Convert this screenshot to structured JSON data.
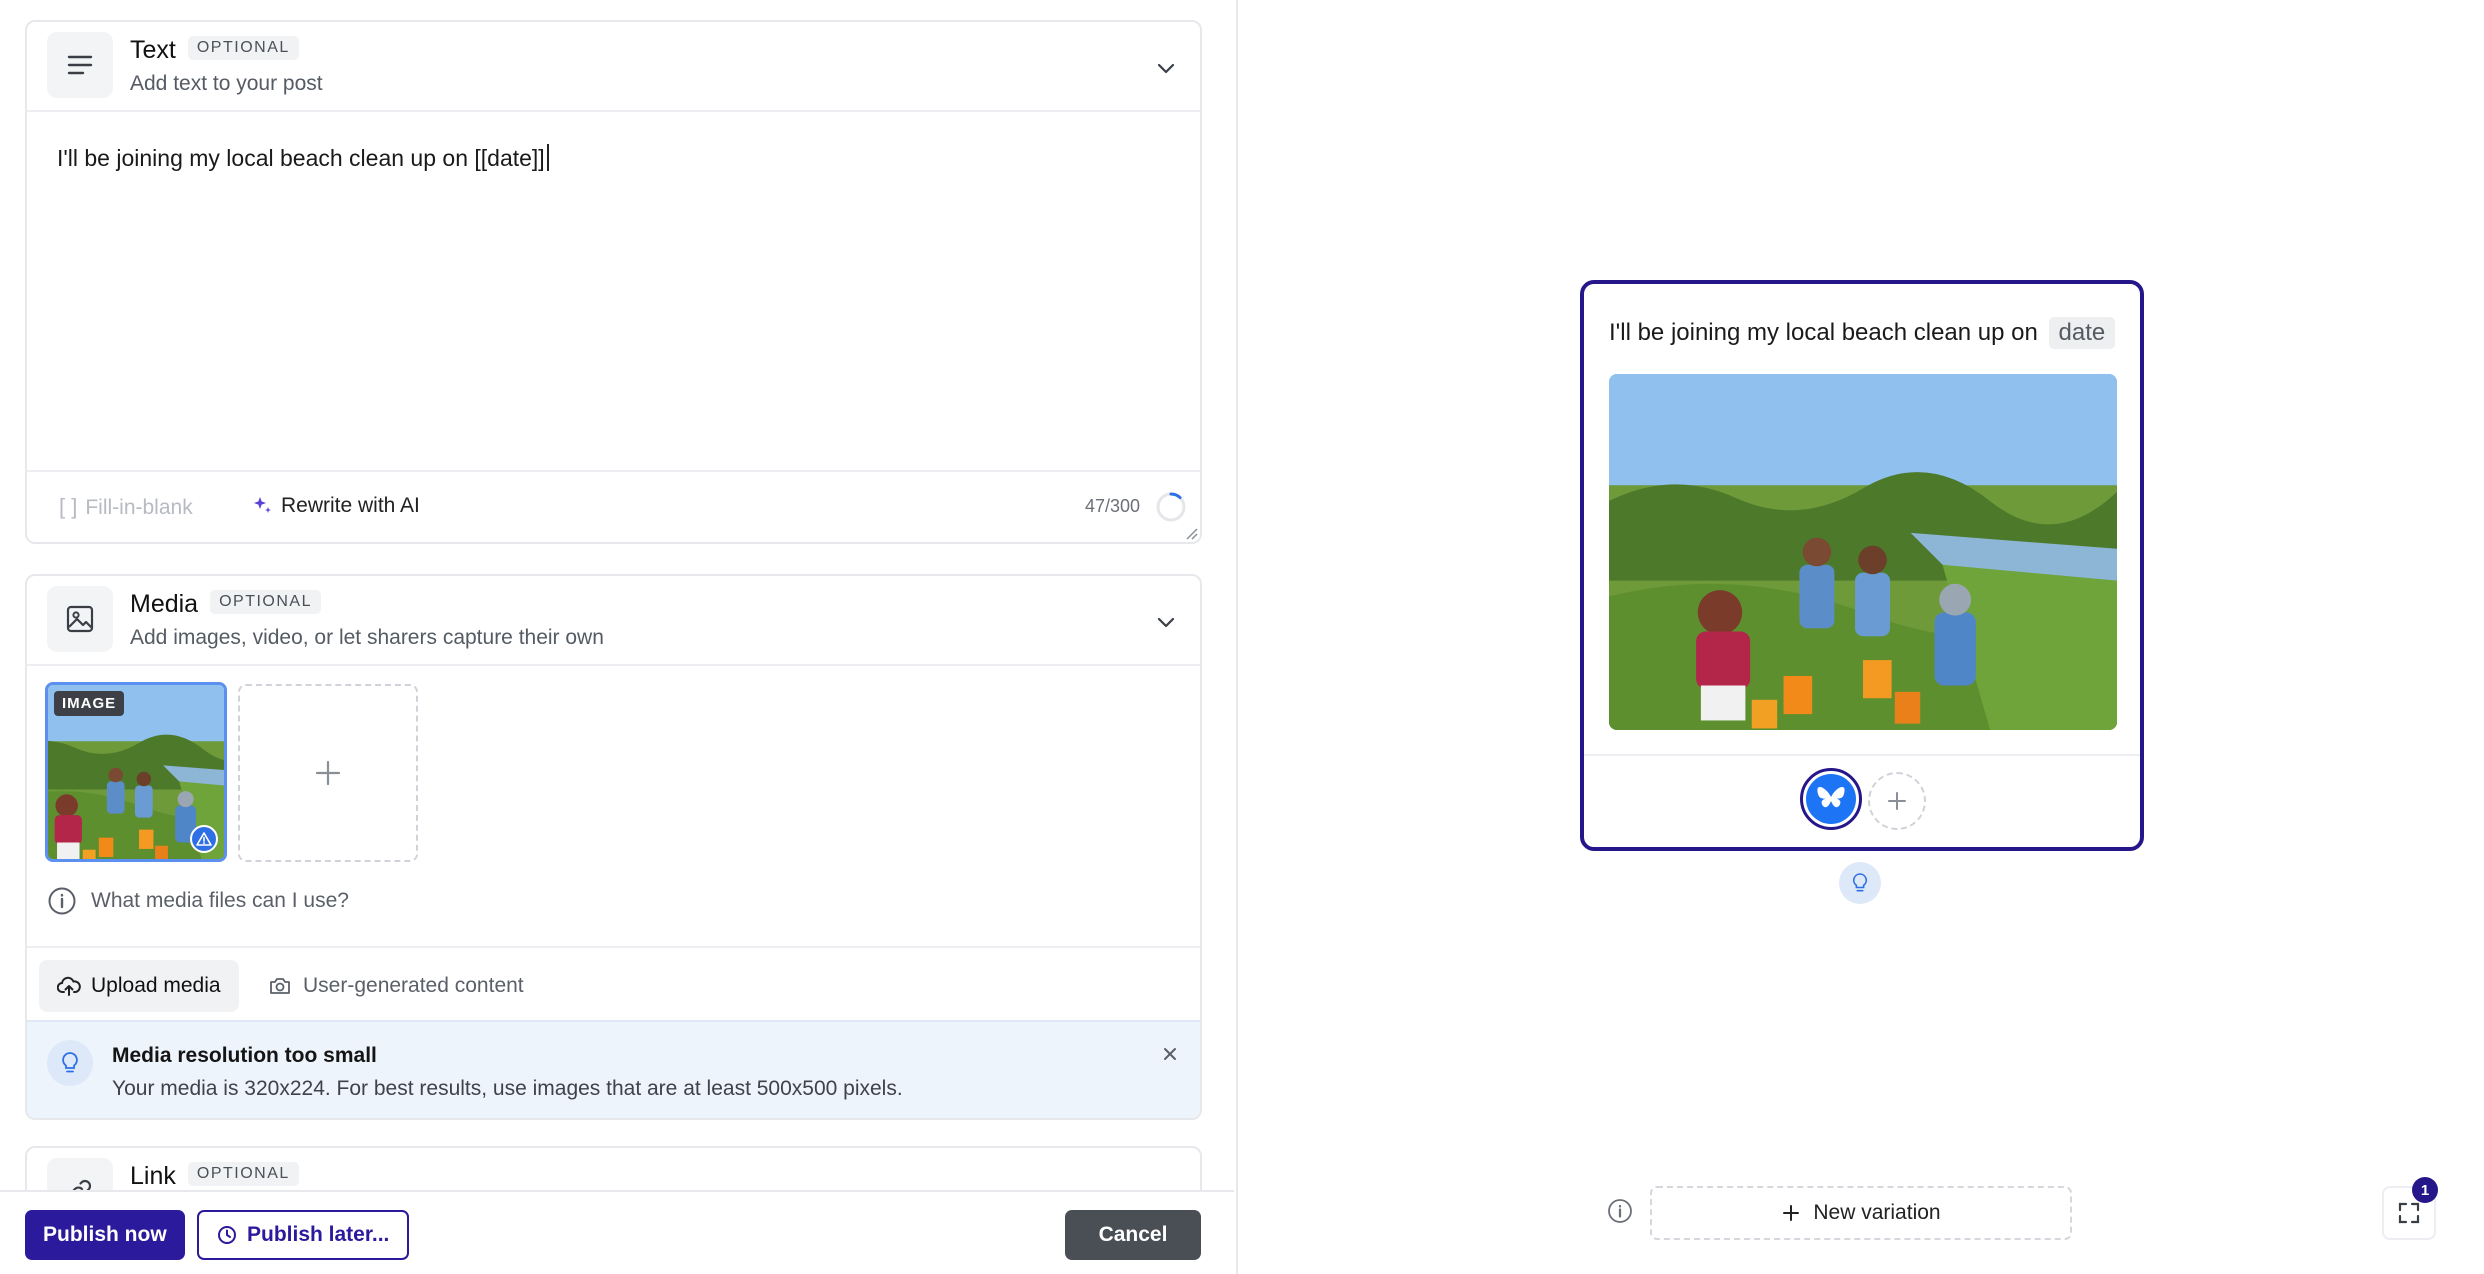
{
  "text_section": {
    "title": "Text",
    "badge": "OPTIONAL",
    "subtitle": "Add text to your post",
    "content": "I'll be joining my local beach clean up on [[date]]",
    "fill_in_blank": "Fill-in-blank",
    "rewrite": "Rewrite with AI",
    "counter": "47/300"
  },
  "media_section": {
    "title": "Media",
    "badge": "OPTIONAL",
    "subtitle": "Add images, video, or let sharers capture their own",
    "thumb_label": "IMAGE",
    "help": "What media files can I use?",
    "upload": "Upload media",
    "ugc": "User-generated content",
    "notice_title": "Media resolution too small",
    "notice_body": "Your media is 320x224. For best results, use images that are at least 500x500 pixels."
  },
  "link_section": {
    "title": "Link",
    "badge": "OPTIONAL"
  },
  "footer": {
    "publish_now": "Publish now",
    "publish_later": "Publish later...",
    "cancel": "Cancel"
  },
  "preview": {
    "text": "I'll be joining my local beach clean up on",
    "chip": "date",
    "new_variation": "New variation",
    "expand_count": "1"
  },
  "colors": {
    "primary": "#2c1a9c",
    "preview_border": "#251789",
    "bluesky": "#1d74f5",
    "notice_bg": "#eef4fb"
  }
}
